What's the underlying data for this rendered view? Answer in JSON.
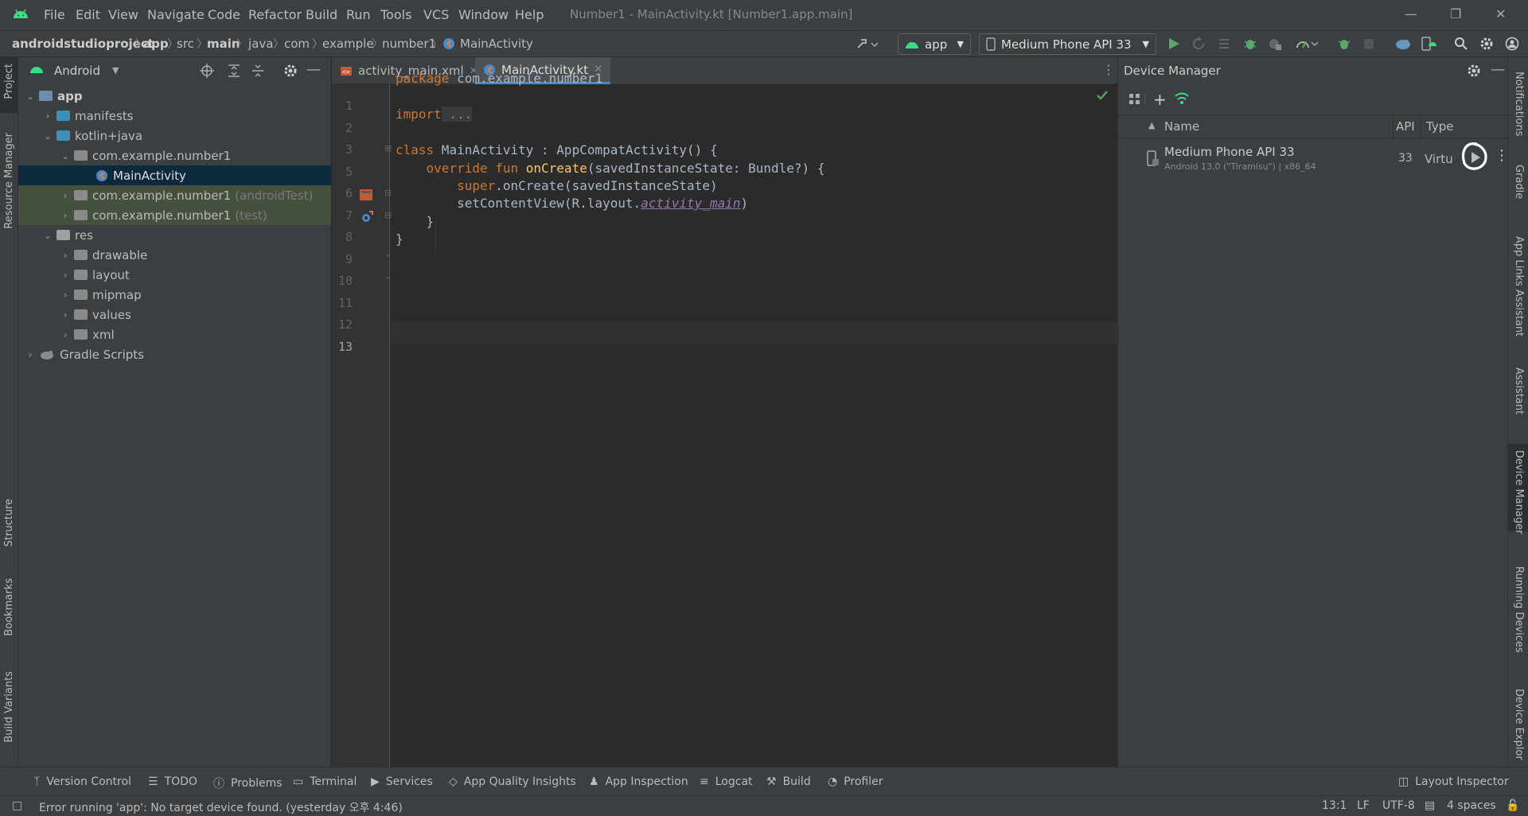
{
  "menu": {
    "items": [
      "File",
      "Edit",
      "View",
      "Navigate",
      "Code",
      "Refactor",
      "Build",
      "Run",
      "Tools",
      "VCS",
      "Window",
      "Help"
    ],
    "window_title": "Number1 - MainActivity.kt [Number1.app.main]"
  },
  "nav": {
    "breadcrumbs": [
      "androidstudioproject",
      "app",
      "src",
      "main",
      "java",
      "com",
      "example",
      "number1",
      "MainActivity"
    ],
    "run_config": "app",
    "device": "Medium Phone API 33"
  },
  "left_stripe": {
    "project": "Project",
    "resource_manager": "Resource Manager",
    "structure": "Structure",
    "bookmarks": "Bookmarks",
    "build_variants": "Build Variants"
  },
  "project_panel": {
    "view_mode": "Android",
    "tree": [
      {
        "label": "app",
        "bold": true
      },
      {
        "label": "manifests"
      },
      {
        "label": "kotlin+java"
      },
      {
        "label": "com.example.number1"
      },
      {
        "label": "MainActivity",
        "selected": true
      },
      {
        "label": "com.example.number1",
        "suffix": "(androidTest)"
      },
      {
        "label": "com.example.number1",
        "suffix": "(test)"
      },
      {
        "label": "res"
      },
      {
        "label": "drawable"
      },
      {
        "label": "layout"
      },
      {
        "label": "mipmap"
      },
      {
        "label": "values"
      },
      {
        "label": "xml"
      },
      {
        "label": "Gradle Scripts"
      }
    ]
  },
  "editor": {
    "tabs": [
      "activity_main.xml",
      "MainActivity.kt"
    ],
    "active_tab": "MainActivity.kt",
    "line_numbers": [
      "1",
      "2",
      "3",
      "5",
      "6",
      "7",
      "8",
      "9",
      "10",
      "11",
      "12",
      "13"
    ],
    "code": {
      "l1_kw": "package",
      "l1_rest": " com.example.number1",
      "l3_kw": "import",
      "l3_rest": " ...",
      "l6_kw": "class",
      "l6_rest": " MainActivity : AppCompatActivity() {",
      "l7_kw": "override fun",
      "l7_fn": "onCreate",
      "l7_rest": "(savedInstanceState: Bundle?) {",
      "l8_kw": "super",
      "l8_rest": ".onCreate(savedInstanceState)",
      "l9_pre": "setContentView(R.layout.",
      "l9_prop": "activity_main",
      "l9_post": ")",
      "l10": "}",
      "l11": "}"
    }
  },
  "device_manager": {
    "title": "Device Manager",
    "columns": {
      "name": "Name",
      "api": "API",
      "type": "Type"
    },
    "devices": [
      {
        "name": "Medium Phone API 33",
        "sub": "Android 13.0 (\"Tiramisu\") | x86_64",
        "api": "33",
        "type": "Virtu"
      }
    ]
  },
  "right_stripe": {
    "notifications": "Notifications",
    "gradle": "Gradle",
    "app_links": "App Links Assistant",
    "assistant": "Assistant",
    "device_manager": "Device Manager",
    "running_devices": "Running Devices",
    "device_explorer": "Device Explor"
  },
  "tool_windows": {
    "version_control": "Version Control",
    "todo": "TODO",
    "problems": "Problems",
    "terminal": "Terminal",
    "services": "Services",
    "aqi": "App Quality Insights",
    "app_inspection": "App Inspection",
    "logcat": "Logcat",
    "build": "Build",
    "profiler": "Profiler",
    "layout_inspector": "Layout Inspector"
  },
  "status": {
    "message": "Error running 'app': No target device found. (yesterday 오후 4:46)",
    "position": "13:1",
    "line_sep": "LF",
    "encoding": "UTF-8",
    "indent": "4 spaces"
  },
  "colors": {
    "accent": "#4a88c7",
    "android_green": "#3ddc84",
    "run_green": "#59a869",
    "keyword": "#cc7832",
    "function": "#ffc66d",
    "property": "#9876aa"
  }
}
